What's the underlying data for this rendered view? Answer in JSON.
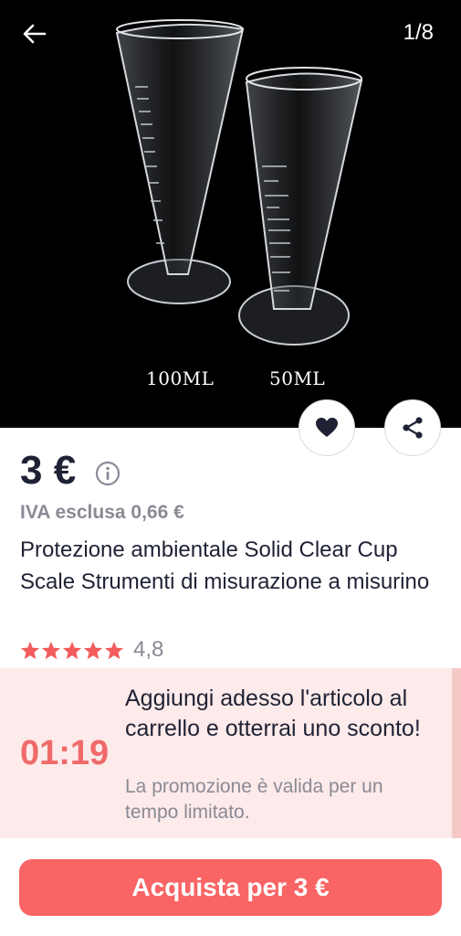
{
  "gallery": {
    "counter": "1/8",
    "labels": [
      "100ML",
      "50ML"
    ]
  },
  "product": {
    "price": "3 €",
    "vat": "IVA esclusa 0,66 €",
    "title": "Protezione ambientale Solid Clear Cup Scale Strumenti di misurazione a misurino",
    "rating": "4,8",
    "stars": 5
  },
  "promo": {
    "timer": "01:19",
    "headline": "Aggiungi adesso l'articolo al carrello e otterrai uno sconto!",
    "subtext": "La promozione è valida per un tempo limitato."
  },
  "cta": {
    "buy_label": "Acquista per 3 €"
  },
  "colors": {
    "accent": "#f96464",
    "timer": "#f06a6a",
    "promo_bg": "#fdeaea",
    "star": "#f25c5c"
  },
  "icons": [
    "arrow-back-icon",
    "heart-icon",
    "share-icon",
    "info-icon",
    "star-icon"
  ]
}
